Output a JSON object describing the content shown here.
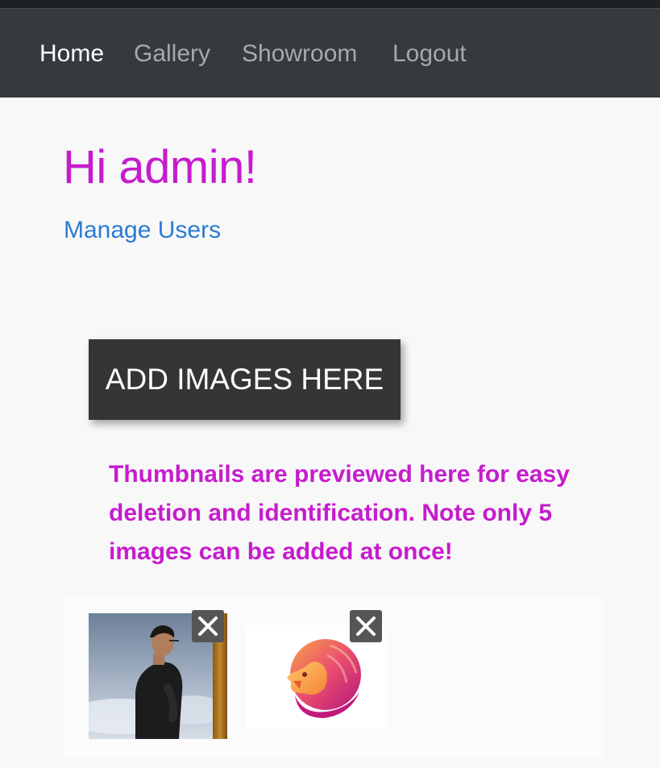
{
  "nav": {
    "items": [
      {
        "label": "Home",
        "active": true
      },
      {
        "label": "Gallery",
        "active": false
      },
      {
        "label": "Showroom",
        "active": false
      },
      {
        "label": "Logout",
        "active": false
      }
    ]
  },
  "main": {
    "greeting": "Hi admin!",
    "manage_users_link": "Manage Users",
    "add_images_button": "ADD IMAGES HERE",
    "note": "Thumbnails are previewed here for easy deletion and identification. Note only 5 images can be added at once!"
  },
  "thumbnails": [
    {
      "icon": "person-photo",
      "remove_icon": "close-icon"
    },
    {
      "icon": "lion-logo",
      "remove_icon": "close-icon"
    }
  ],
  "colors": {
    "navbar": "#353a3d",
    "nav_active": "#ffffff",
    "nav_inactive": "#a7a9ab",
    "accent_magenta": "#c61ccd",
    "link_blue": "#2a7bd3",
    "button_dark": "#353535"
  }
}
